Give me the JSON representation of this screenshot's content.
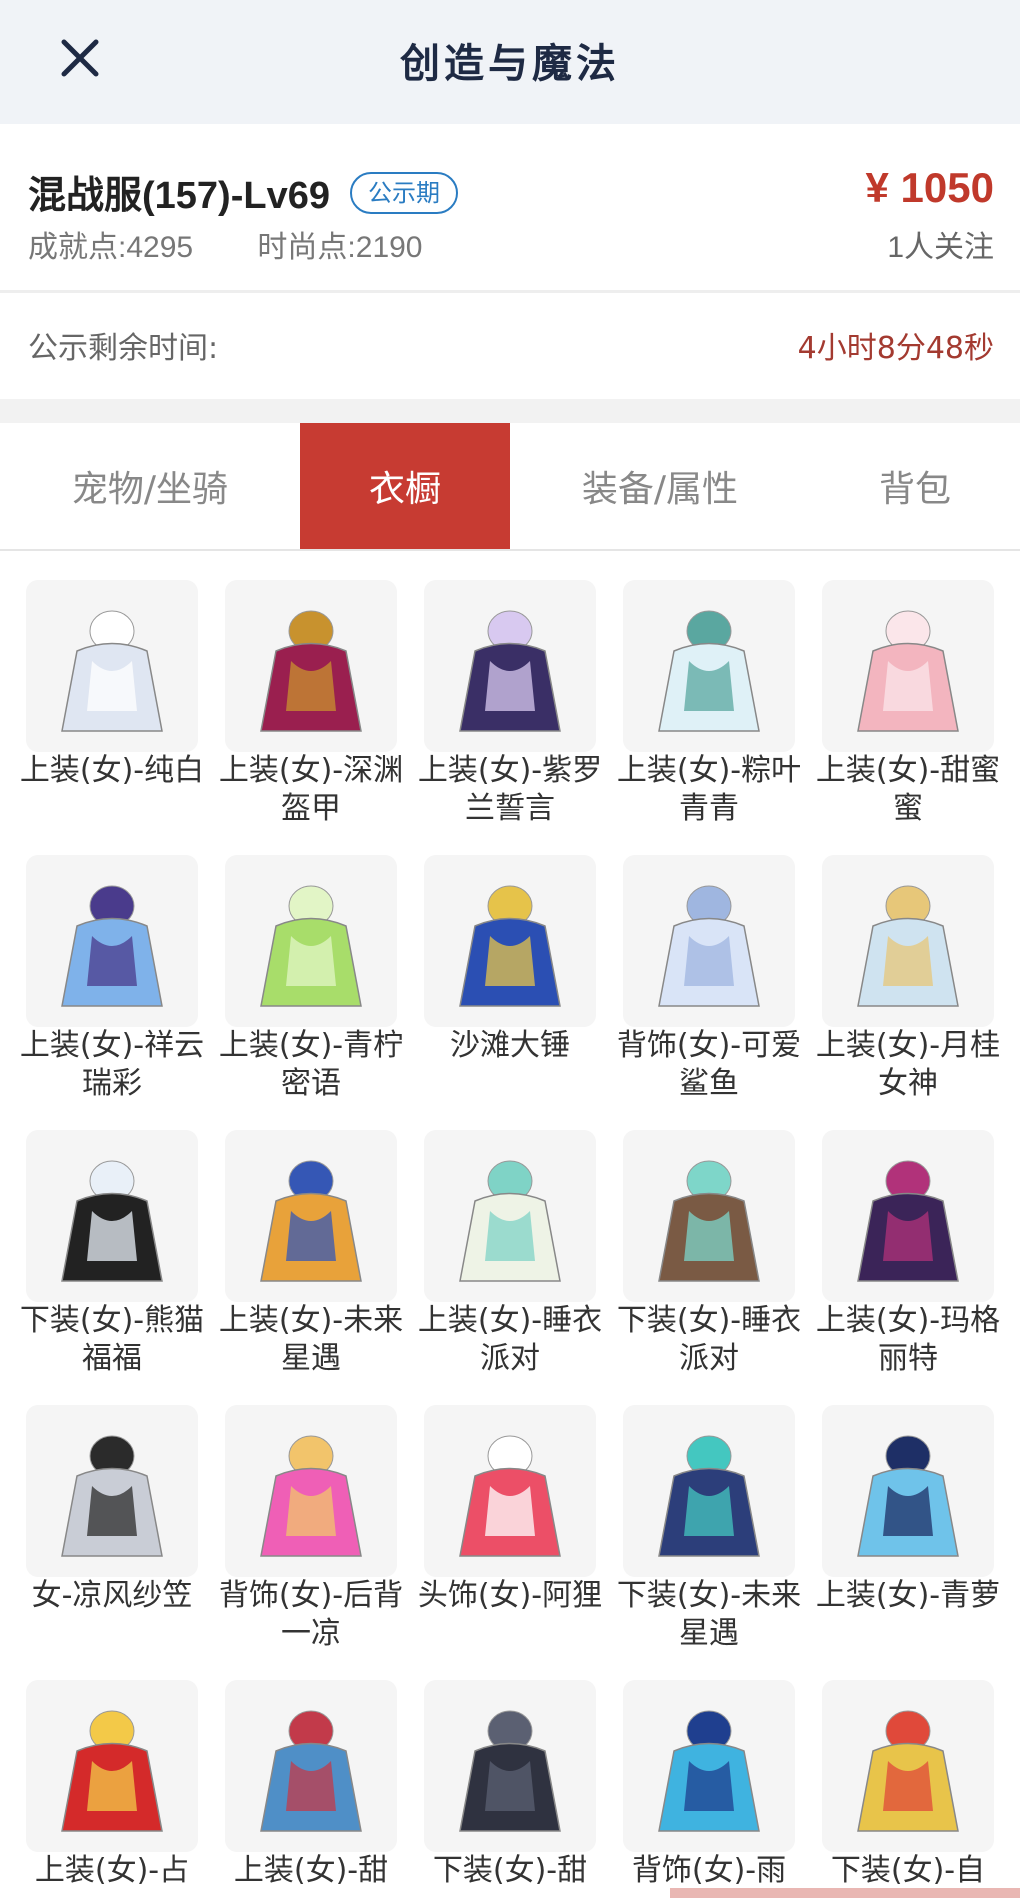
{
  "header": {
    "title": "创造与魔法",
    "close_icon": "close-icon"
  },
  "listing": {
    "server": "混战服(157)-Lv69",
    "badge": "公示期",
    "achievement": "成就点:4295",
    "fashion": "时尚点:2190",
    "price": "¥ 1050",
    "followers": "1人关注"
  },
  "notice": {
    "label": "公示剩余时间:",
    "remaining": "4小时8分48秒"
  },
  "tabs": [
    {
      "label": "宠物/坐骑"
    },
    {
      "label": "衣橱"
    },
    {
      "label": "装备/属性"
    },
    {
      "label": "背包"
    }
  ],
  "active_tab": "衣橱",
  "colors": {
    "accent_red": "#c73b32",
    "badge_blue": "#2a7cc2",
    "price_red": "#c0392b",
    "header_bg": "#f0f3f7"
  },
  "items": [
    {
      "name": "上装(女)-纯白",
      "icon": "white-dress-icon",
      "c1": "#dfe6f2",
      "c2": "#ffffff"
    },
    {
      "name": "上装(女)-深渊盔甲",
      "icon": "armor-icon",
      "c1": "#9a1f4f",
      "c2": "#c8922e"
    },
    {
      "name": "上装(女)-紫罗兰誓言",
      "icon": "violet-dress-icon",
      "c1": "#3a2f66",
      "c2": "#d8c9f0"
    },
    {
      "name": "上装(女)-粽叶青青",
      "icon": "green-dress-icon",
      "c1": "#dff1f7",
      "c2": "#5aa7a0"
    },
    {
      "name": "上装(女)-甜蜜蜜",
      "icon": "pink-dress-icon",
      "c1": "#f3b5bf",
      "c2": "#fbe6ea"
    },
    {
      "name": "上装(女)-祥云瑞彩",
      "icon": "blue-robe-icon",
      "c1": "#7fb2ea",
      "c2": "#4a3b8c"
    },
    {
      "name": "上装(女)-青柠密语",
      "icon": "lime-dress-icon",
      "c1": "#a8dd6a",
      "c2": "#e2f5c6"
    },
    {
      "name": "沙滩大锤",
      "icon": "hammer-icon",
      "c1": "#2b4fb3",
      "c2": "#e6c34a"
    },
    {
      "name": "背饰(女)-可爱鲨鱼",
      "icon": "shark-icon",
      "c1": "#d9e4f7",
      "c2": "#9fb6e0"
    },
    {
      "name": "上装(女)-月桂女神",
      "icon": "laurel-top-icon",
      "c1": "#cfe3f0",
      "c2": "#e7c779"
    },
    {
      "name": "下装(女)-熊猫福福",
      "icon": "panda-skirt-icon",
      "c1": "#222222",
      "c2": "#e9f0f8"
    },
    {
      "name": "上装(女)-未来星遇",
      "icon": "jacket-icon",
      "c1": "#e8a23a",
      "c2": "#3557b5"
    },
    {
      "name": "上装(女)-睡衣派对",
      "icon": "pajama-top-icon",
      "c1": "#eef3e6",
      "c2": "#7fd3c6"
    },
    {
      "name": "下装(女)-睡衣派对",
      "icon": "slippers-icon",
      "c1": "#7a5a44",
      "c2": "#7ed6c9"
    },
    {
      "name": "上装(女)-玛格丽特",
      "icon": "purple-dress-icon",
      "c1": "#3b2458",
      "c2": "#b1327a"
    },
    {
      "name": "女-凉风纱笠",
      "icon": "veil-hat-icon",
      "c1": "#c9cdd6",
      "c2": "#2b2b2b"
    },
    {
      "name": "背饰(女)-后背一凉",
      "icon": "icecream-icon",
      "c1": "#ef5fb6",
      "c2": "#f2c46b"
    },
    {
      "name": "头饰(女)-阿狸",
      "icon": "fox-head-icon",
      "c1": "#ec4f67",
      "c2": "#ffffff"
    },
    {
      "name": "下装(女)-未来星遇",
      "icon": "boots-icon",
      "c1": "#2c3e7a",
      "c2": "#44c7c0"
    },
    {
      "name": "上装(女)-青萝",
      "icon": "blue-gown-icon",
      "c1": "#6fc3ea",
      "c2": "#1e2f66"
    },
    {
      "name": "上装(女)-占",
      "icon": "red-dress-icon",
      "c1": "#d42a2a",
      "c2": "#f3c948"
    },
    {
      "name": "上装(女)-甜",
      "icon": "denim-dress-icon",
      "c1": "#4f8fc7",
      "c2": "#c23a4a"
    },
    {
      "name": "下装(女)-甜",
      "icon": "tiered-skirt-icon",
      "c1": "#2f3240",
      "c2": "#5b6072"
    },
    {
      "name": "背饰(女)-雨",
      "icon": "flute-icon",
      "c1": "#3fb3e0",
      "c2": "#1f3f8f"
    },
    {
      "name": "下装(女)-自",
      "icon": "tassel-skirt-icon",
      "c1": "#e8c44a",
      "c2": "#e0493a"
    }
  ]
}
